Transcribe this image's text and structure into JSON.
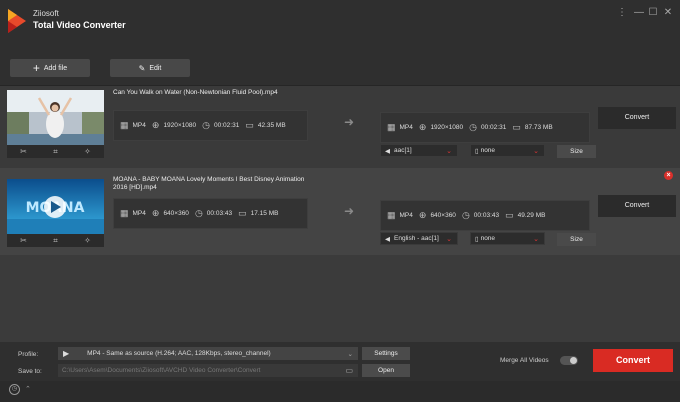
{
  "app": {
    "brand": "Ziiosoft",
    "title": "Total Video Converter"
  },
  "window_controls": [
    "⋮",
    "—",
    "☐",
    "✕"
  ],
  "toolbar": {
    "add_file": "Add file",
    "edit": "Edit"
  },
  "files": [
    {
      "name": "Can You Walk on Water (Non-Newtonian Fluid Pool).mp4",
      "source": {
        "format": "MP4",
        "resolution": "1920×1080",
        "duration": "00:02:31",
        "size": "42.35 MB"
      },
      "output": {
        "format": "MP4",
        "resolution": "1920×1080",
        "duration": "00:02:31",
        "size": "87.73 MB"
      },
      "audio": "aac[1]",
      "subtitle": "none",
      "size_button": "Size",
      "convert_button": "Convert"
    },
    {
      "name": "MOANA - BABY MOANA Lovely Moments I Best Disney Animation 2016 [HD].mp4",
      "source": {
        "format": "MP4",
        "resolution": "640×360",
        "duration": "00:03:43",
        "size": "17.15 MB"
      },
      "output": {
        "format": "MP4",
        "resolution": "640×360",
        "duration": "00:03:43",
        "size": "49.29 MB"
      },
      "audio": "English - aac[1]",
      "subtitle": "none",
      "size_button": "Size",
      "convert_button": "Convert",
      "thumb_text": "MOANA"
    }
  ],
  "bottom": {
    "profile_label": "Profile:",
    "profile_value": "MP4 - Same as source (H.264; AAC, 128Kbps, stereo_channel)",
    "settings_button": "Settings",
    "save_label": "Save to:",
    "save_path": "C:\\Users\\Asem\\Documents\\Ziiosoft\\AVCHD Video Converter\\Convert",
    "open_button": "Open",
    "merge_label": "Merge All Videos",
    "merge_on": false,
    "convert_button": "Convert"
  },
  "colors": {
    "accent": "#d92b23",
    "background": "#3b3b3b"
  }
}
